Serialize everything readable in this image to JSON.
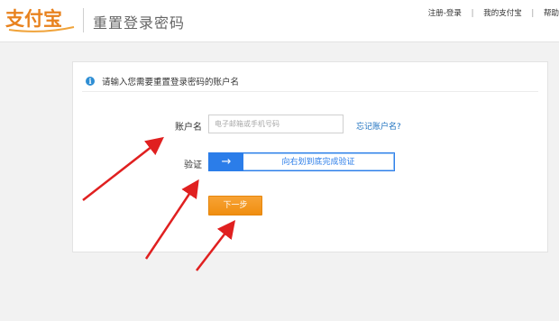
{
  "header": {
    "logo_text": "支付宝",
    "title": "重置登录密码",
    "nav": {
      "register_label": "注册",
      "dash": " - ",
      "login_label": "登录",
      "my_alipay_label": "我的支付宝",
      "help_label": "帮助"
    }
  },
  "form": {
    "notice": "请输入您需要重置登录密码的账户名",
    "account_label": "账户名",
    "account_placeholder": "电子邮箱或手机号码",
    "account_value": "",
    "forgot_link": "忘记账户名?",
    "verify_label": "验证",
    "slider_text": "向右划到底完成验证",
    "next_button": "下一步"
  },
  "colors": {
    "accent_blue": "#2b7de9",
    "button_orange": "#f08e10",
    "logo_orange": "#e8821e",
    "arrow_red": "#e02020"
  }
}
